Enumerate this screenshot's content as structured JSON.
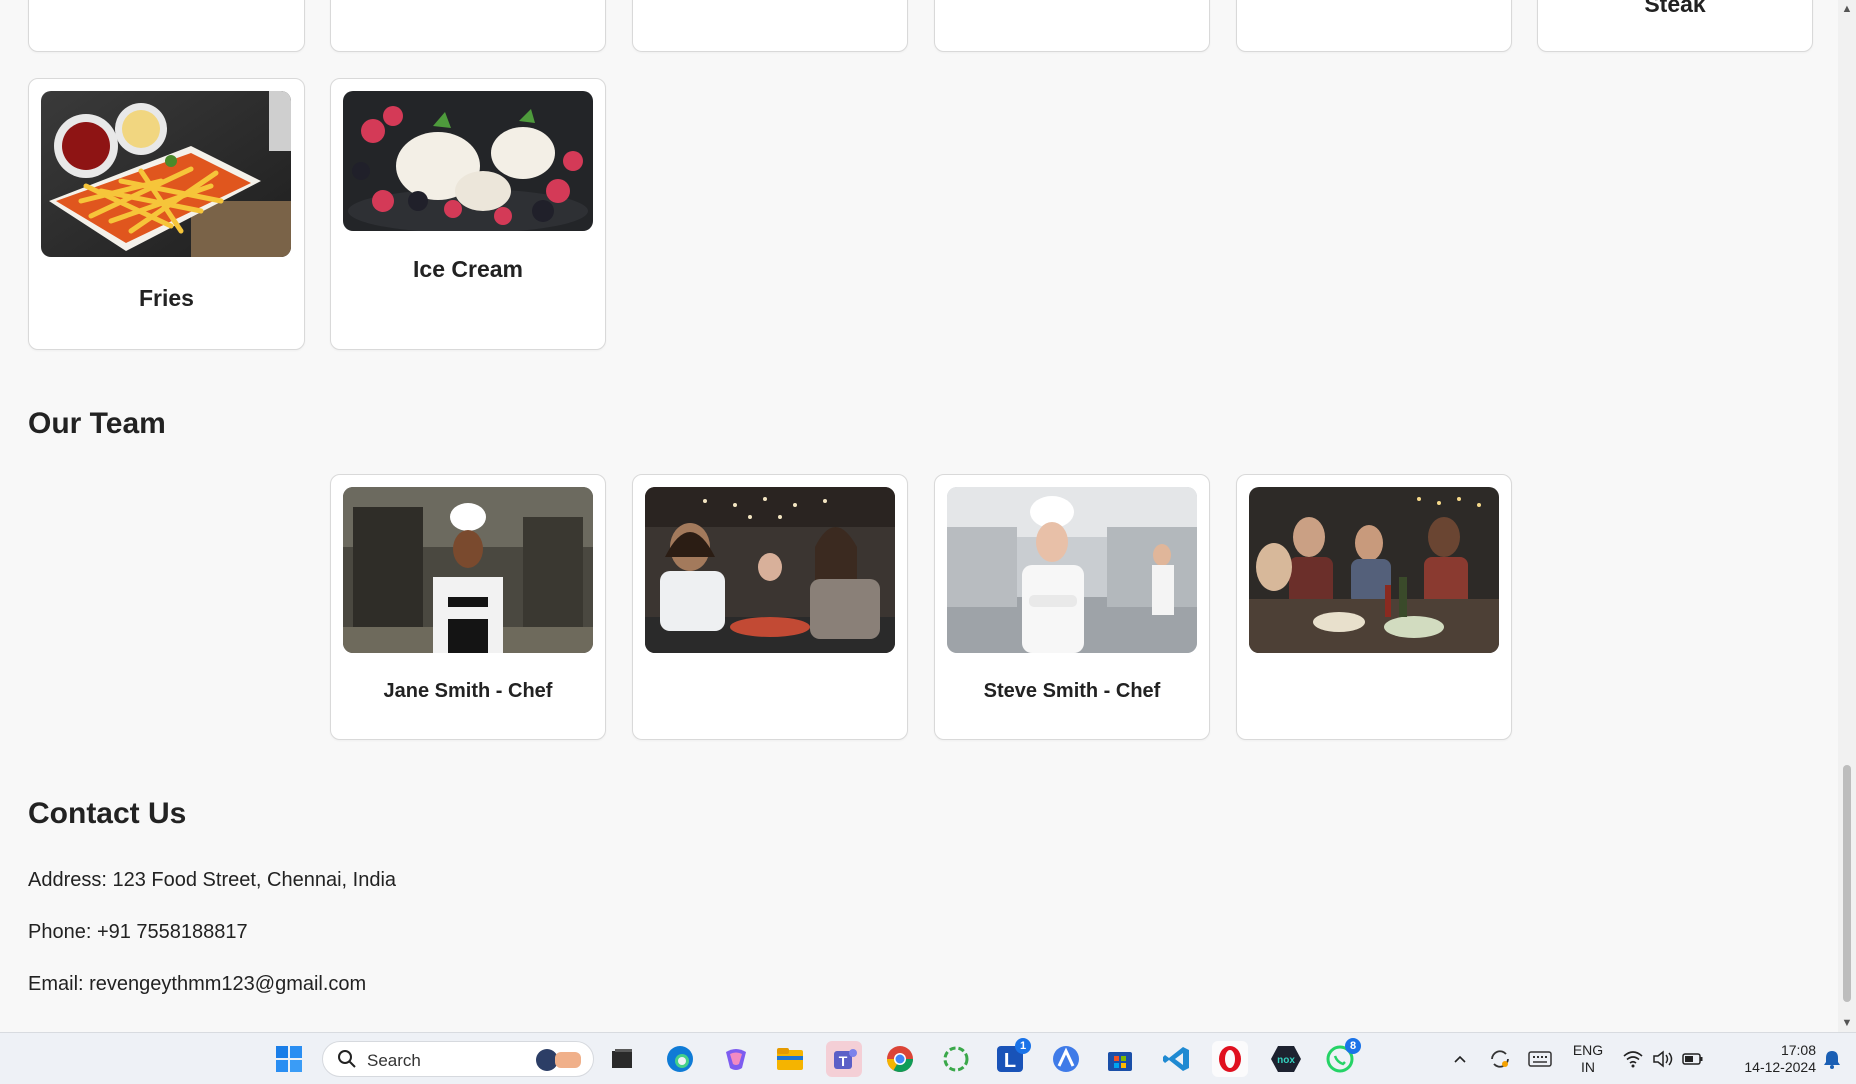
{
  "menu": {
    "partial_top_title": "Steak",
    "items": [
      {
        "label": "Fries",
        "image": "fries-photo"
      },
      {
        "label": "Ice Cream",
        "image": "ice-cream-photo"
      }
    ]
  },
  "team": {
    "heading": "Our Team",
    "members": [
      {
        "label": "Jane Smith - Chef",
        "image": "chef-woman-kitchen-photo"
      },
      {
        "label": "",
        "image": "diners-laughing-photo"
      },
      {
        "label": "Steve Smith - Chef",
        "image": "chef-man-kitchen-photo"
      },
      {
        "label": "",
        "image": "group-dinner-photo"
      }
    ]
  },
  "contact": {
    "heading": "Contact Us",
    "address": "Address: 123 Food Street, Chennai, India",
    "phone": "Phone: +91 7558188817",
    "email": "Email: revengeythmm123@gmail.com"
  },
  "taskbar": {
    "search_placeholder": "Search",
    "apps": [
      {
        "name": "windows-start-icon"
      },
      {
        "name": "search-icon"
      },
      {
        "name": "task-view-icon"
      },
      {
        "name": "edge-icon"
      },
      {
        "name": "copilot-icon"
      },
      {
        "name": "file-explorer-icon"
      },
      {
        "name": "teams-icon"
      },
      {
        "name": "chrome-icon"
      },
      {
        "name": "loading-circle-icon"
      },
      {
        "name": "l-app-icon",
        "badge": "1"
      },
      {
        "name": "a-app-icon"
      },
      {
        "name": "store-icon"
      },
      {
        "name": "vscode-icon"
      },
      {
        "name": "opera-icon"
      },
      {
        "name": "nox-icon"
      },
      {
        "name": "whatsapp-icon",
        "badge": "8"
      }
    ],
    "tray": {
      "language_line1": "ENG",
      "language_line2": "IN",
      "time": "17:08",
      "date": "14-12-2024"
    }
  },
  "colors": {
    "page_bg": "#f8f8f8",
    "card_border": "#d9d9d9",
    "taskbar_bg": "#eef1f6",
    "badge_blue": "#1a73e8"
  }
}
